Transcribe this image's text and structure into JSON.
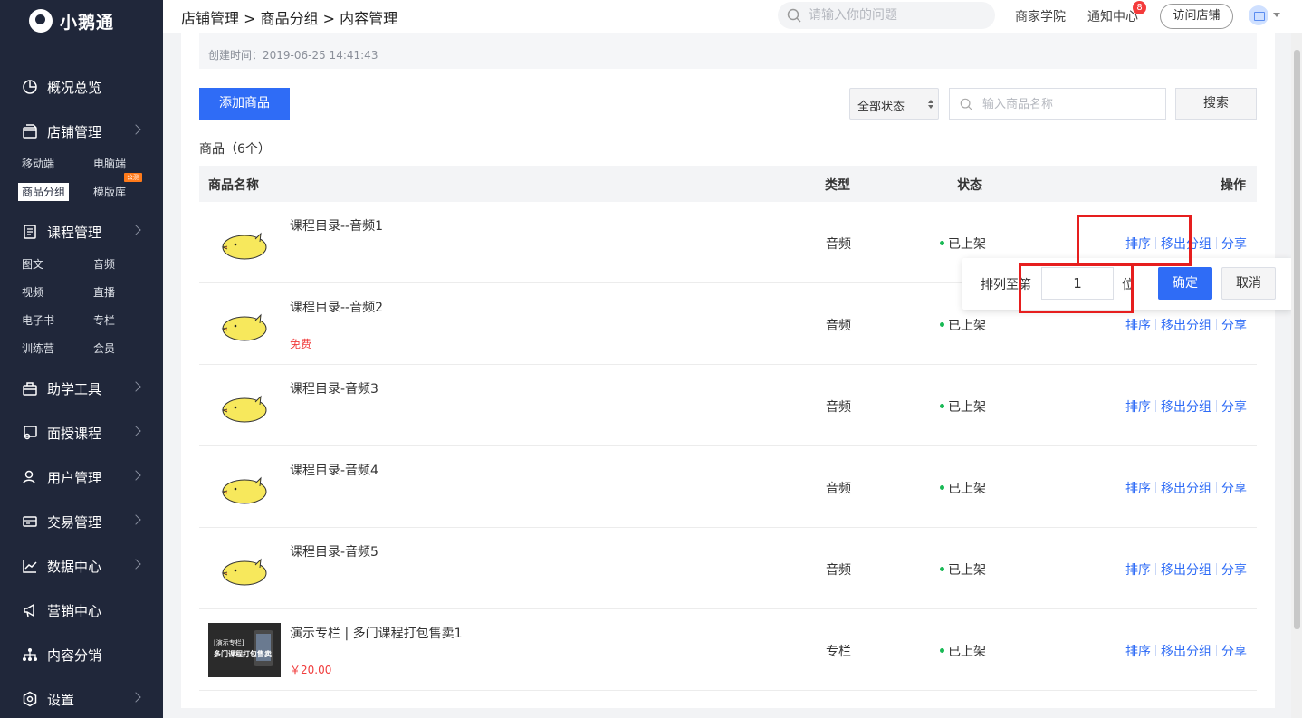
{
  "app": {
    "name": "小鹅通"
  },
  "sidebar": {
    "groups": [
      {
        "label": "概况总览",
        "icon": "pie-chart-icon",
        "has_arrow": false
      },
      {
        "label": "店铺管理",
        "icon": "store-icon",
        "has_arrow": true
      },
      {
        "label": "课程管理",
        "icon": "document-icon",
        "has_arrow": true
      },
      {
        "label": "助学工具",
        "icon": "toolbox-icon",
        "has_arrow": true
      },
      {
        "label": "面授课程",
        "icon": "teacher-icon",
        "has_arrow": true
      },
      {
        "label": "用户管理",
        "icon": "user-icon",
        "has_arrow": true
      },
      {
        "label": "交易管理",
        "icon": "card-icon",
        "has_arrow": true
      },
      {
        "label": "数据中心",
        "icon": "trend-icon",
        "has_arrow": true
      },
      {
        "label": "营销中心",
        "icon": "megaphone-icon",
        "has_arrow": false
      },
      {
        "label": "内容分销",
        "icon": "network-icon",
        "has_arrow": false
      },
      {
        "label": "设置",
        "icon": "settings-icon",
        "has_arrow": true
      }
    ],
    "store_subs": [
      "移动端",
      "电脑端",
      "商品分组",
      "模版库"
    ],
    "store_active": "商品分组",
    "new_tag": "公测",
    "course_subs": [
      "图文",
      "音频",
      "视频",
      "直播",
      "电子书",
      "专栏",
      "训练营",
      "会员"
    ]
  },
  "header": {
    "breadcrumb": "店铺管理 > 商品分组 > 内容管理",
    "search_placeholder": "请输入你的问题",
    "academy": "商家学院",
    "notifications": "通知中心",
    "notification_count": "8",
    "visit_store": "访问店铺"
  },
  "main": {
    "created_time": "创建时间：2019-06-25 14:41:43",
    "add_button": "添加商品",
    "status_filter": "全部状态",
    "name_search_placeholder": "输入商品名称",
    "search_button": "搜索",
    "count_label": "商品（6个）",
    "columns": [
      "商品名称",
      "类型",
      "状态",
      "操作"
    ],
    "rows": [
      {
        "name": "课程目录--音频1",
        "tag": "",
        "type": "音频",
        "status": "已上架",
        "thumb": "chick"
      },
      {
        "name": "课程目录--音频2",
        "tag": "免费",
        "type": "音频",
        "status": "已上架",
        "thumb": "chick"
      },
      {
        "name": "课程目录-音频3",
        "tag": "",
        "type": "音频",
        "status": "已上架",
        "thumb": "chick"
      },
      {
        "name": "课程目录-音频4",
        "tag": "",
        "type": "音频",
        "status": "已上架",
        "thumb": "chick"
      },
      {
        "name": "课程目录-音频5",
        "tag": "",
        "type": "音频",
        "status": "已上架",
        "thumb": "chick"
      },
      {
        "name": "演示专栏 | 多门课程打包售卖1",
        "tag": "￥20.00",
        "type": "专栏",
        "status": "已上架",
        "thumb": "column"
      }
    ],
    "actions": {
      "sort": "排序",
      "move_out": "移出分组",
      "share": "分享"
    },
    "column_thumb_text": [
      "[演示专栏]",
      "多门课程打包售卖"
    ]
  },
  "sort_popover": {
    "label": "排列至第",
    "value": "1",
    "unit": "位",
    "confirm": "确定",
    "cancel": "取消"
  },
  "colors": {
    "primary": "#2f6cf6",
    "sidebar": "#20273a",
    "published": "#19b955",
    "price": "#f03c3c",
    "highlight": "#e61e1e"
  }
}
